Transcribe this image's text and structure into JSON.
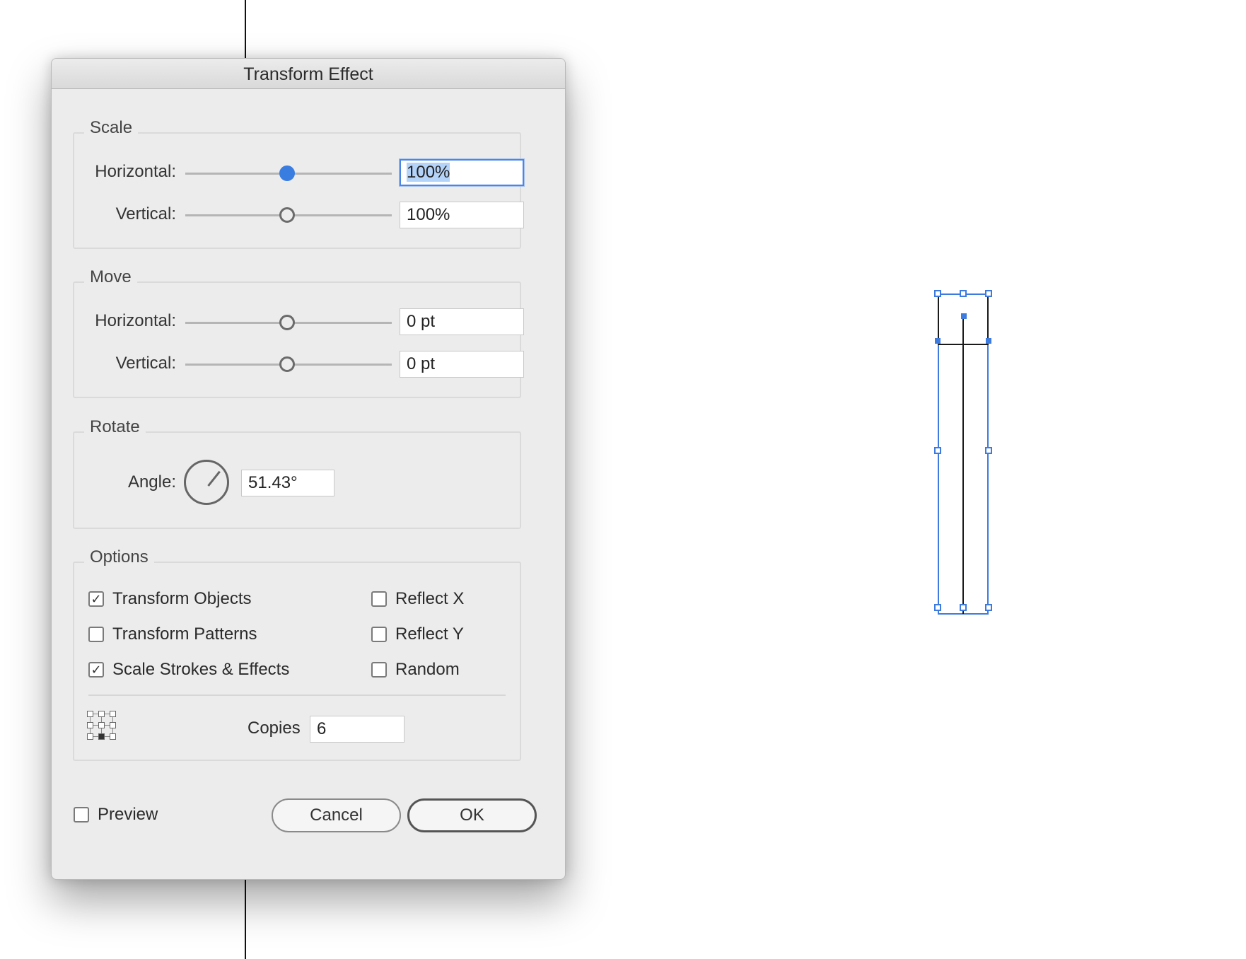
{
  "dialog": {
    "title": "Transform Effect",
    "scale": {
      "label": "Scale",
      "horizontal_label": "Horizontal:",
      "horizontal_value": "100%",
      "vertical_label": "Vertical:",
      "vertical_value": "100%"
    },
    "move": {
      "label": "Move",
      "horizontal_label": "Horizontal:",
      "horizontal_value": "0 pt",
      "vertical_label": "Vertical:",
      "vertical_value": "0 pt"
    },
    "rotate": {
      "label": "Rotate",
      "angle_label": "Angle:",
      "angle_value": "51.43°"
    },
    "options": {
      "label": "Options",
      "transform_objects": {
        "label": "Transform Objects",
        "checked": true
      },
      "transform_patterns": {
        "label": "Transform Patterns",
        "checked": false
      },
      "scale_strokes": {
        "label": "Scale Strokes & Effects",
        "checked": true
      },
      "reflect_x": {
        "label": "Reflect X",
        "checked": false
      },
      "reflect_y": {
        "label": "Reflect Y",
        "checked": false
      },
      "random": {
        "label": "Random",
        "checked": false
      },
      "copies_label": "Copies",
      "copies_value": "6",
      "reference_point_icon": "reference-point-grid-icon"
    },
    "preview": {
      "label": "Preview",
      "checked": false
    },
    "cancel_label": "Cancel",
    "ok_label": "OK"
  },
  "colors": {
    "accent": "#3a7de0",
    "selection": "#3d7bdf",
    "dialog_bg": "#ececec"
  }
}
